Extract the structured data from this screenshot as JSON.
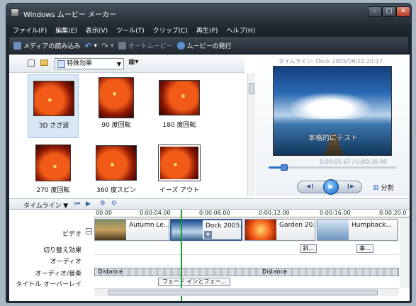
{
  "window": {
    "title": "Windows ムービー メーカー"
  },
  "menu": [
    "ファイル(F)",
    "編集(E)",
    "表示(V)",
    "ツール(T)",
    "クリップ(C)",
    "再生(P)",
    "ヘルプ(H)"
  ],
  "toolbar": {
    "import": "メディアの読み込み",
    "auto_movie": "オートムービー",
    "publish": "ムービーの発行"
  },
  "effects": {
    "dropdown": "特殊効果",
    "tiles": [
      "3D さざ波",
      "90 度回転",
      "180 度回転",
      "270 度回転",
      "360 度スピン",
      "イーズ アウト"
    ]
  },
  "preview": {
    "timeline_label": "タイムライン: Dock 2005/06/22 20:17",
    "caption": "本格的にテスト",
    "time": "0:00:05.67 / 0:00:30.00",
    "split": "分割",
    "seek_progress": 0.12
  },
  "timeline": {
    "label": "タイムライン",
    "ruler": [
      "00.00",
      "0:00:04.00",
      "0:00:08.00",
      "0:00:12.00",
      "0:00:16.00",
      "0:00:20.0"
    ],
    "track_labels": {
      "video": "ビデオ",
      "transition": "切り替え効果",
      "audio": "オーディオ",
      "audio_music": "オーディオ/音楽",
      "title_overlay": "タイトル オーバーレイ"
    },
    "clips": [
      "Autumn Le...",
      "Dock 2005...",
      "Garden 20...",
      "Humpback..."
    ],
    "transitions": [
      "斜...",
      "事..."
    ],
    "audio_clips": [
      "Distance",
      "Distance"
    ],
    "title_clip": "フェード インとフェー..."
  }
}
